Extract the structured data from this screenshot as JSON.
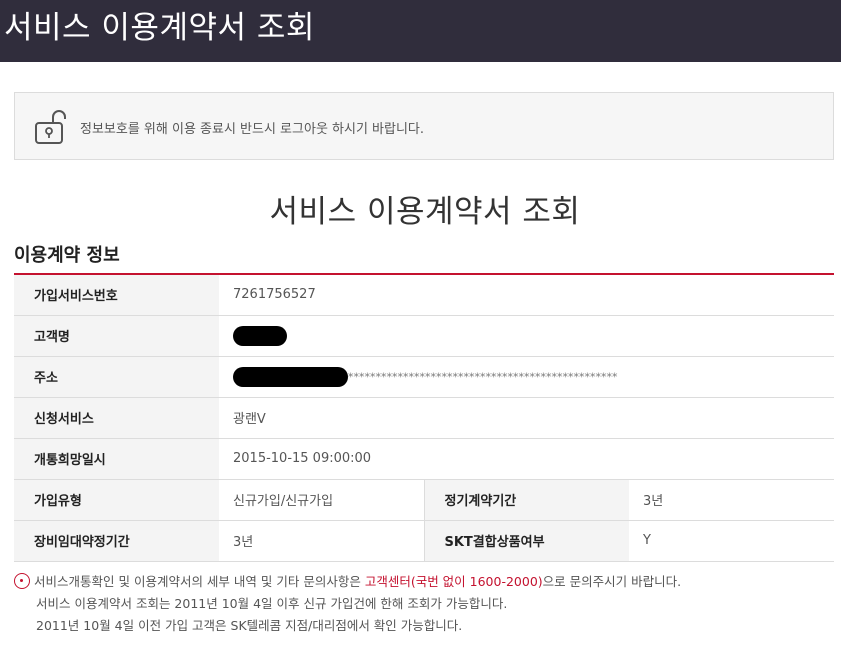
{
  "header": {
    "title": "서비스 이용계약서 조회"
  },
  "notice": {
    "icon": "unlock-icon",
    "text": "정보보호를 위해 이용 종료시 반드시 로그아웃 하시기 바랍니다."
  },
  "page_title": "서비스 이용계약서 조회",
  "section_title": "이용계약 정보",
  "contract": {
    "service_number_label": "가입서비스번호",
    "service_number": "7261756527",
    "customer_name_label": "고객명",
    "address_label": "주소",
    "address_mask": "*************************************************",
    "service_label": "신청서비스",
    "service": "광랜V",
    "activation_label": "개통희망일시",
    "activation_datetime": "2015-10-15 09:00:00",
    "join_type_label": "가입유형",
    "join_type": "신규가입/신규가입",
    "contract_period_label": "정기계약기간",
    "contract_period": "3년",
    "equipment_period_label": "장비임대약정기간",
    "equipment_period": "3년",
    "bundle_label": "SKT결합상품여부",
    "bundle": "Y"
  },
  "notes": {
    "line1_prefix": "서비스개통확인 및 이용계약서의 세부 내역 및 기타 문의사항은",
    "line1_link": "고객센터(국번 없이 1600-2000)",
    "line1_suffix": "으로 문의주시기 바랍니다.",
    "line2": "서비스 이용계약서 조회는 2011년 10월 4일 이후 신규 가입건에 한해 조회가 가능합니다.",
    "line3": "2011년 10월 4일 이전 가입 고객은 SK텔레콤 지점/대리점에서 확인 가능합니다."
  },
  "colors": {
    "header_bg": "#302d3c",
    "accent": "#c4122f"
  }
}
